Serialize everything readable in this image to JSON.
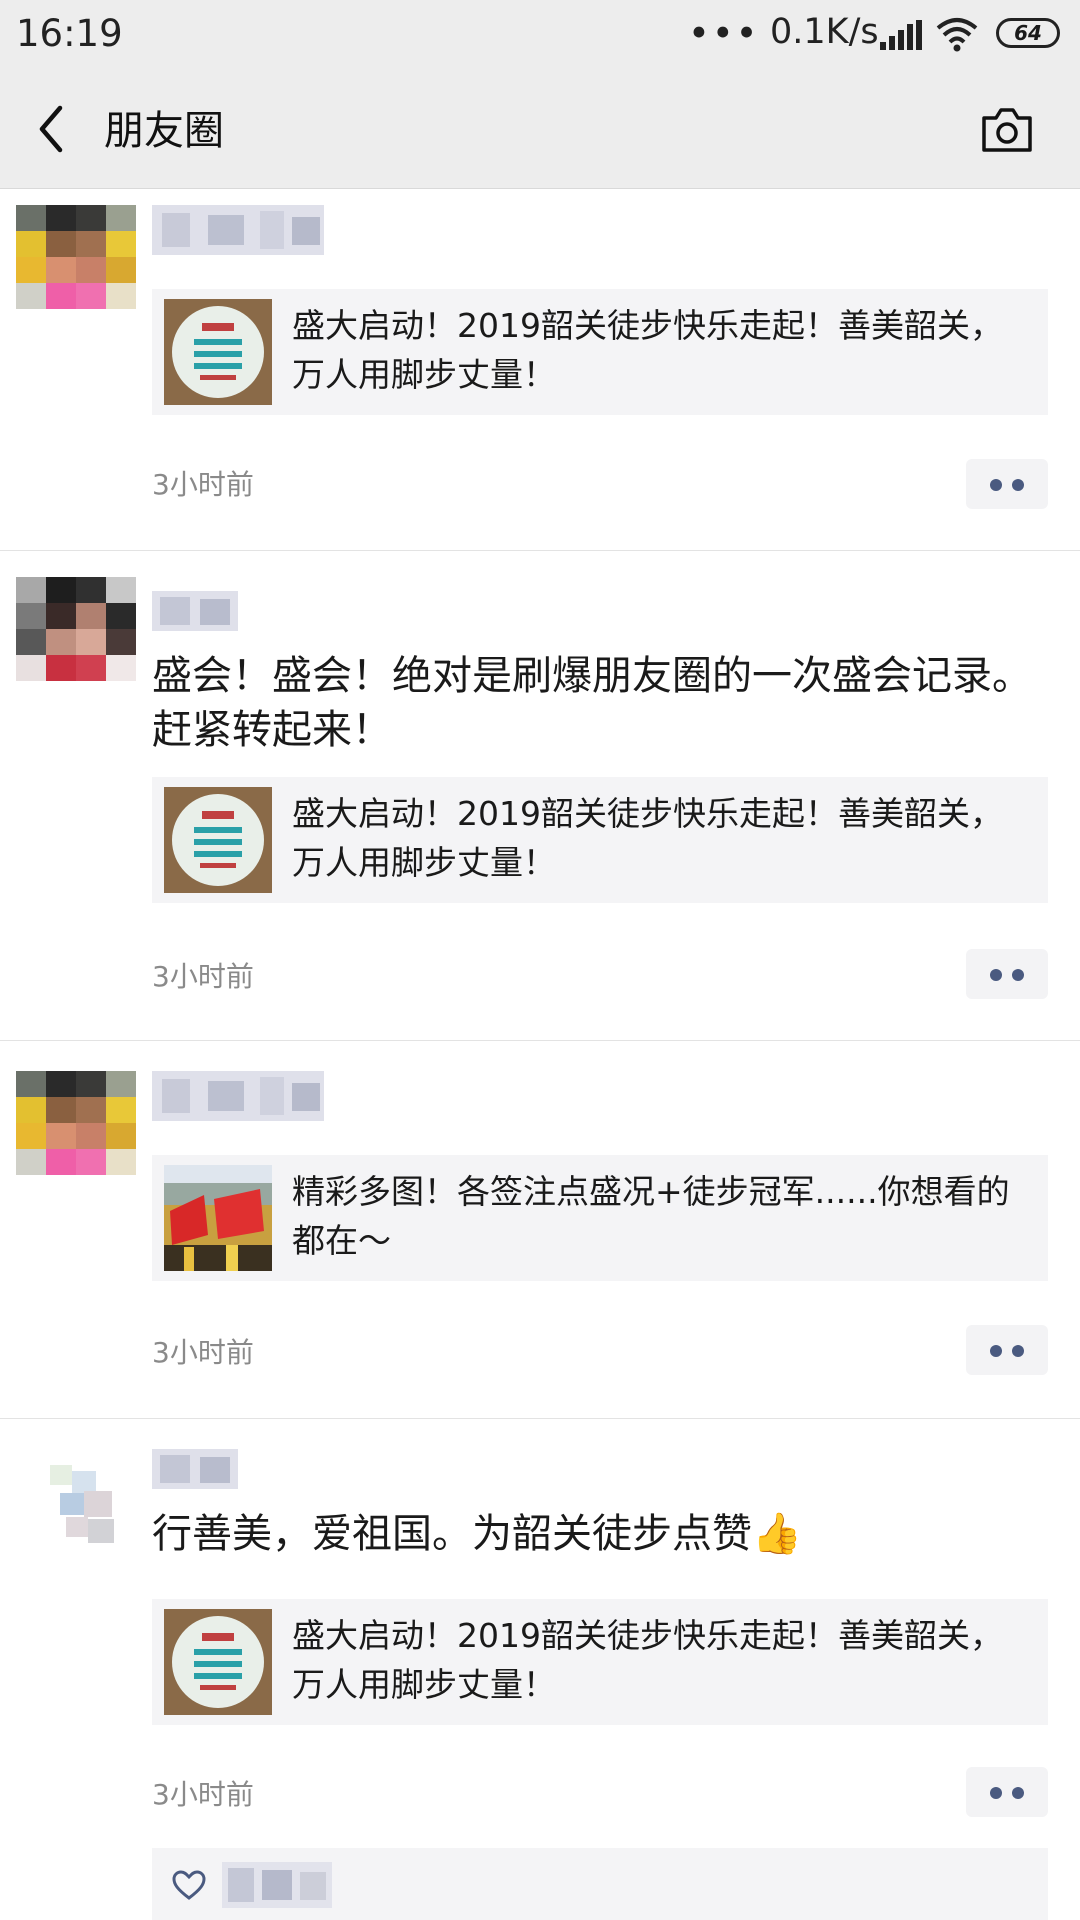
{
  "status_bar": {
    "time": "16:19",
    "more": "•••",
    "speed": "0.1K/s",
    "battery": "64"
  },
  "nav": {
    "title": "朋友圈",
    "back_icon": "chevron-left-icon",
    "camera_icon": "camera-icon"
  },
  "posts": [
    {
      "text": "",
      "link_title": "盛大启动！2019韶关徒步快乐走起！善美韶关，万人用脚步丈量！",
      "time": "3小时前"
    },
    {
      "text": "盛会！盛会！绝对是刷爆朋友圈的一次盛会记录。赶紧转起来！",
      "link_title": "盛大启动！2019韶关徒步快乐走起！善美韶关，万人用脚步丈量！",
      "time": "3小时前"
    },
    {
      "text": "",
      "link_title": "精彩多图！各签注点盛况+徒步冠军......你想看的都在～",
      "time": "3小时前"
    },
    {
      "text": "行善美，爱祖国。为韶关徒步点赞👍",
      "link_title": "盛大启动！2019韶关徒步快乐走起！善美韶关，万人用脚步丈量！",
      "time": "3小时前"
    }
  ],
  "colors": {
    "header_bg": "#ededed",
    "card_bg": "#f4f4f6",
    "timestamp": "#8a8a8a",
    "action_dots": "#4a5a80"
  }
}
